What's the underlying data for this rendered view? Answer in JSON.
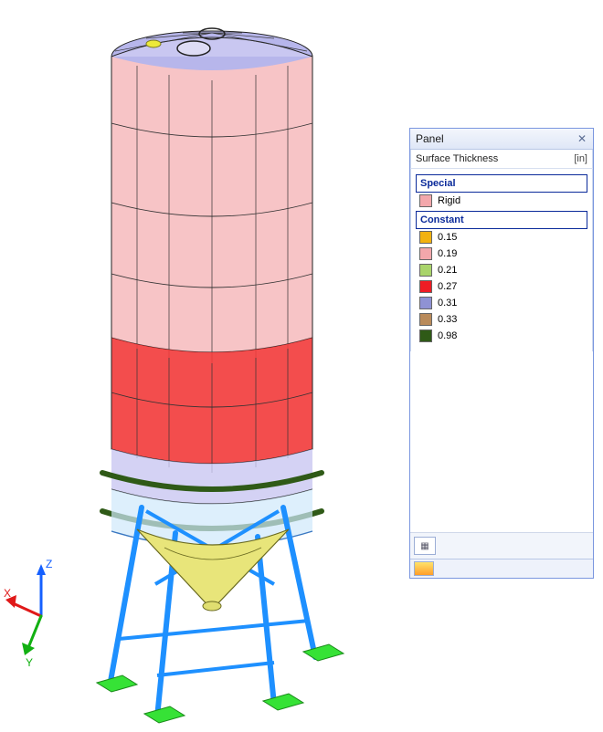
{
  "panel": {
    "title": "Panel",
    "close": "✕",
    "subtitle": "Surface Thickness",
    "unit": "[in]",
    "group_special": "Special",
    "rigid_label": "Rigid",
    "rigid_color": "#f3a7ab",
    "group_constant": "Constant",
    "entries": [
      {
        "color": "#f2b20f",
        "value": "0.15"
      },
      {
        "color": "#f3a7ab",
        "value": "0.19"
      },
      {
        "color": "#a9d46a",
        "value": "0.21"
      },
      {
        "color": "#ef1c24",
        "value": "0.27"
      },
      {
        "color": "#8f92d4",
        "value": "0.31"
      },
      {
        "color": "#b98a5a",
        "value": "0.33"
      },
      {
        "color": "#2f5a17",
        "value": "0.98"
      }
    ],
    "footer_icon": "▦"
  },
  "axes": {
    "x": "X",
    "y": "Y",
    "z": "Z"
  },
  "model_description": "Cylindrical steel silo on four-leg support frame with conical hopper, colored by surface thickness."
}
